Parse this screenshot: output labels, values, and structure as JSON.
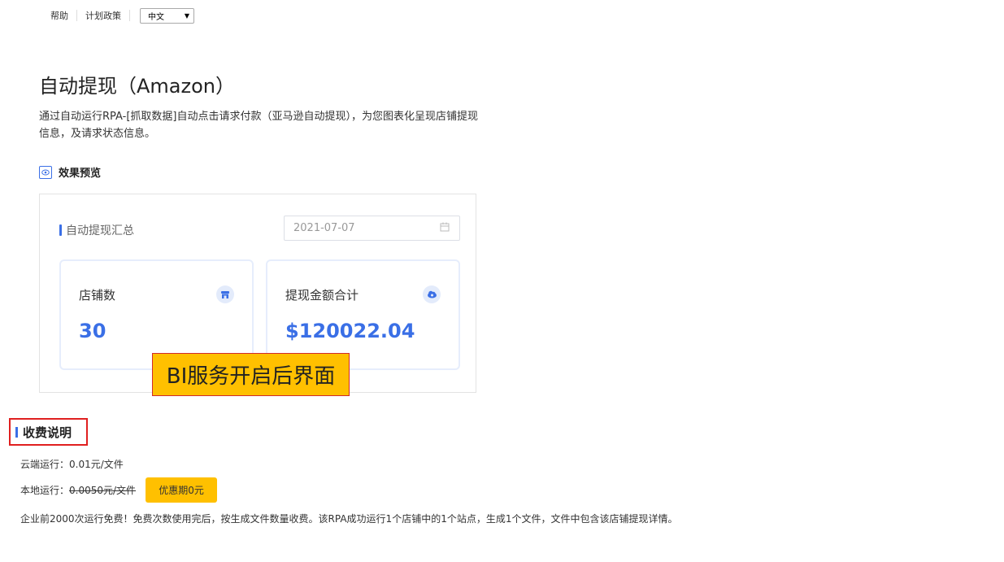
{
  "topbar": {
    "help": "帮助",
    "plan_policy": "计划政策",
    "language": "中文"
  },
  "page": {
    "title": "自动提现（Amazon）",
    "description": "通过自动运行RPA-[抓取数据]自动点击请求付款（亚马逊自动提现），为您图表化呈现店铺提现信息，及请求状态信息。",
    "preview_label": "效果预览"
  },
  "preview": {
    "title": "自动提现汇总",
    "date_value": "2021-07-07",
    "cards": [
      {
        "label": "店铺数",
        "value": "30",
        "icon": "store-icon"
      },
      {
        "label": "提现金额合计",
        "value": "$120022.04",
        "icon": "cloud-money-icon"
      }
    ]
  },
  "overlay": {
    "bi_tag": "BI服务开启后界面"
  },
  "fees": {
    "heading": "收费说明",
    "cloud_label": "云端运行：",
    "cloud_price": "0.01元/文件",
    "local_label": "本地运行：",
    "local_price": "0.0050元/文件",
    "promo_button": "优惠期0元",
    "note": "企业前2000次运行免费！免费次数使用完后，按生成文件数量收费。该RPA成功运行1个店铺中的1个站点，生成1个文件，文件中包含该店铺提现详情。"
  },
  "colors": {
    "accent": "#3a6fe6",
    "highlight": "#ffc000",
    "alert_border": "#e02020"
  }
}
